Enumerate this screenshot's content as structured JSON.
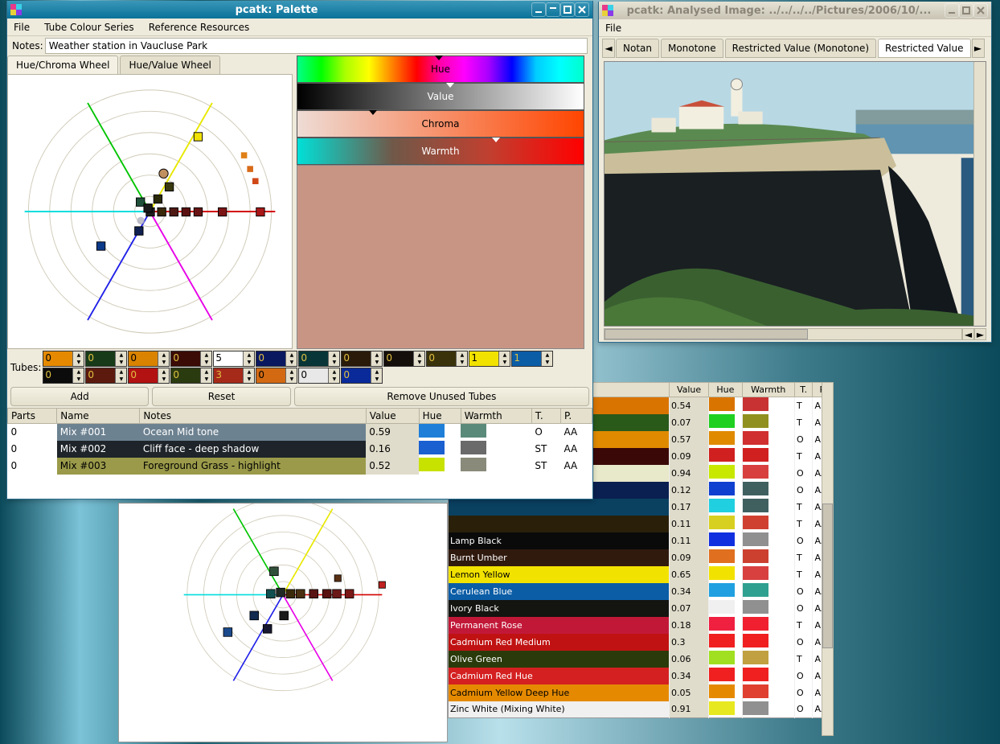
{
  "palette_window": {
    "title": "pcatk: Palette",
    "menu": [
      "File",
      "Tube Colour Series",
      "Reference Resources"
    ],
    "notes_label": "Notes:",
    "notes_value": "Weather station in Vaucluse Park",
    "wheel_tabs": [
      "Hue/Chroma Wheel",
      "Hue/Value Wheel"
    ],
    "active_wheel_tab": 0,
    "sliders": [
      {
        "label": "Hue"
      },
      {
        "label": "Value"
      },
      {
        "label": "Chroma"
      },
      {
        "label": "Warmth"
      }
    ],
    "tubes_label": "Tubes:",
    "tubes": [
      [
        {
          "v": "0",
          "bg": "#e58a00"
        },
        {
          "v": "0",
          "bg": "#173b18"
        },
        {
          "v": "0",
          "bg": "#d98300"
        },
        {
          "v": "0",
          "bg": "#3b0b06"
        },
        {
          "v": "5",
          "bg": "#ffffff"
        },
        {
          "v": "0",
          "bg": "#0a1860"
        },
        {
          "v": "0",
          "bg": "#083638"
        },
        {
          "v": "0",
          "bg": "#2a1a0a"
        },
        {
          "v": "0",
          "bg": "#140f0a"
        },
        {
          "v": "0",
          "bg": "#3a320a"
        },
        {
          "v": "1",
          "bg": "#f2e200"
        },
        {
          "v": "1",
          "bg": "#0b5da6"
        },
        {
          "v": "",
          "bg": "transparent",
          "empty": true
        }
      ],
      [
        {
          "v": "0",
          "bg": "#0b0b0b"
        },
        {
          "v": "0",
          "bg": "#5c1a0e"
        },
        {
          "v": "0",
          "bg": "#b31212"
        },
        {
          "v": "0",
          "bg": "#2b3b10"
        },
        {
          "v": "3",
          "bg": "#a62a1a"
        },
        {
          "v": "0",
          "bg": "#d36a12"
        },
        {
          "v": "0",
          "bg": "#e8e8e8"
        },
        {
          "v": "0",
          "bg": "#0a2a9a"
        },
        {
          "v": "",
          "bg": "transparent",
          "empty": true
        },
        {
          "v": "",
          "bg": "transparent",
          "empty": true
        },
        {
          "v": "",
          "bg": "transparent",
          "empty": true
        },
        {
          "v": "",
          "bg": "transparent",
          "empty": true
        },
        {
          "v": "",
          "bg": "transparent",
          "empty": true
        }
      ]
    ],
    "buttons": {
      "add": "Add",
      "reset": "Reset",
      "remove": "Remove Unused Tubes"
    },
    "mix_headers": [
      "Parts",
      "Name",
      "Notes",
      "Value",
      "Hue",
      "Warmth",
      "T.",
      "P."
    ],
    "mixes": [
      {
        "parts": "0",
        "name": "Mix #001",
        "notes": "Ocean Mid tone",
        "value": "0.59",
        "hue": "#1f7fd8",
        "warmth": "#5a8a7a",
        "t": "O",
        "p": "AA",
        "row_bg": "#6d8291",
        "row_fg": "#fff"
      },
      {
        "parts": "0",
        "name": "Mix #002",
        "notes": "Cliff face - deep shadow",
        "value": "0.16",
        "hue": "#1a60d0",
        "warmth": "#6a6a6a",
        "t": "ST",
        "p": "AA",
        "row_bg": "#1e2429",
        "row_fg": "#fff"
      },
      {
        "parts": "0",
        "name": "Mix #003",
        "notes": "Foreground Grass - highlight",
        "value": "0.52",
        "hue": "#c8e200",
        "warmth": "#8a8a7a",
        "t": "ST",
        "p": "AA",
        "row_bg": "#9a9a4a",
        "row_fg": "#000"
      }
    ]
  },
  "image_window": {
    "title": "pcatk: Analysed Image: ../../../../Pictures/2006/10/...",
    "menu": [
      "File"
    ],
    "tabs": [
      "Notan",
      "Monotone",
      "Restricted Value (Monotone)",
      "Restricted Value"
    ],
    "active_tab": 3
  },
  "paint_list": {
    "headers": [
      "Value",
      "Hue",
      "Warmth",
      "T.",
      "P."
    ],
    "rows": [
      {
        "name": "",
        "row_bg": "#d97400",
        "v": "0.54",
        "hue": "#d97400",
        "warmth": "#c83232",
        "t": "T",
        "p": "A"
      },
      {
        "name": "",
        "row_bg": "#2a5a1a",
        "v": "0.07",
        "hue": "#20d020",
        "warmth": "#909020",
        "t": "T",
        "p": "A"
      },
      {
        "name": "",
        "row_bg": "#e08a00",
        "v": "0.57",
        "hue": "#e08a00",
        "warmth": "#d03030",
        "t": "O",
        "p": "A"
      },
      {
        "name": "",
        "row_bg": "#3b0808",
        "v": "0.09",
        "hue": "#d02020",
        "warmth": "#d02020",
        "t": "T",
        "p": "A"
      },
      {
        "name": "",
        "row_bg": "#e8e8ca",
        "v": "0.94",
        "hue": "#c8e800",
        "warmth": "#d84040",
        "t": "O",
        "p": "AA"
      },
      {
        "name": "",
        "row_bg": "#0a2050",
        "v": "0.12",
        "hue": "#1040d0",
        "warmth": "#406060",
        "t": "O",
        "p": "AA"
      },
      {
        "name": "",
        "row_bg": "#0a4060",
        "v": "0.17",
        "hue": "#20d0e0",
        "warmth": "#406060",
        "t": "T",
        "p": "AA"
      },
      {
        "name": "",
        "row_bg": "#2a200a",
        "v": "0.11",
        "hue": "#d8d020",
        "warmth": "#d04030",
        "t": "T",
        "p": "AA"
      },
      {
        "name": "Lamp Black",
        "row_bg": "#0a0a0a",
        "v": "0.11",
        "hue": "#1030e0",
        "warmth": "#909090",
        "t": "O",
        "p": "AA",
        "fg": "#fff"
      },
      {
        "name": "Burnt Umber",
        "row_bg": "#301a0e",
        "v": "0.09",
        "hue": "#e07020",
        "warmth": "#cc4030",
        "t": "T",
        "p": "A",
        "fg": "#fff"
      },
      {
        "name": "Lemon Yellow",
        "row_bg": "#f2e200",
        "v": "0.65",
        "hue": "#f2e200",
        "warmth": "#d84040",
        "t": "T",
        "p": "A"
      },
      {
        "name": "Cerulean Blue",
        "row_bg": "#0b5da6",
        "v": "0.34",
        "hue": "#20a0e0",
        "warmth": "#30a090",
        "t": "O",
        "p": "AA",
        "fg": "#fff"
      },
      {
        "name": "Ivory Black",
        "row_bg": "#141410",
        "v": "0.07",
        "hue": "#f0f0f0",
        "warmth": "#909090",
        "t": "O",
        "p": "AA",
        "fg": "#fff"
      },
      {
        "name": "Permanent Rose",
        "row_bg": "#c21838",
        "v": "0.18",
        "hue": "#f02040",
        "warmth": "#f02030",
        "t": "T",
        "p": "A",
        "fg": "#fff"
      },
      {
        "name": "Cadmium Red Medium",
        "row_bg": "#c01212",
        "v": "0.3",
        "hue": "#f02020",
        "warmth": "#f02020",
        "t": "O",
        "p": "A",
        "fg": "#fff"
      },
      {
        "name": "Olive Green",
        "row_bg": "#2a3a0a",
        "v": "0.06",
        "hue": "#a0e020",
        "warmth": "#c0a040",
        "t": "T",
        "p": "A",
        "fg": "#fff"
      },
      {
        "name": "Cadmium Red Hue",
        "row_bg": "#d42020",
        "v": "0.34",
        "hue": "#f02020",
        "warmth": "#f02020",
        "t": "O",
        "p": "A",
        "fg": "#fff"
      },
      {
        "name": "Cadmium Yellow Deep Hue",
        "row_bg": "#e58a00",
        "v": "0.05",
        "hue": "#e58a00",
        "warmth": "#e04030",
        "t": "O",
        "p": "A"
      },
      {
        "name": "Zinc White (Mixing White)",
        "row_bg": "#f0f0f0",
        "v": "0.91",
        "hue": "#e8e820",
        "warmth": "#909090",
        "t": "O",
        "p": "AA"
      }
    ]
  }
}
